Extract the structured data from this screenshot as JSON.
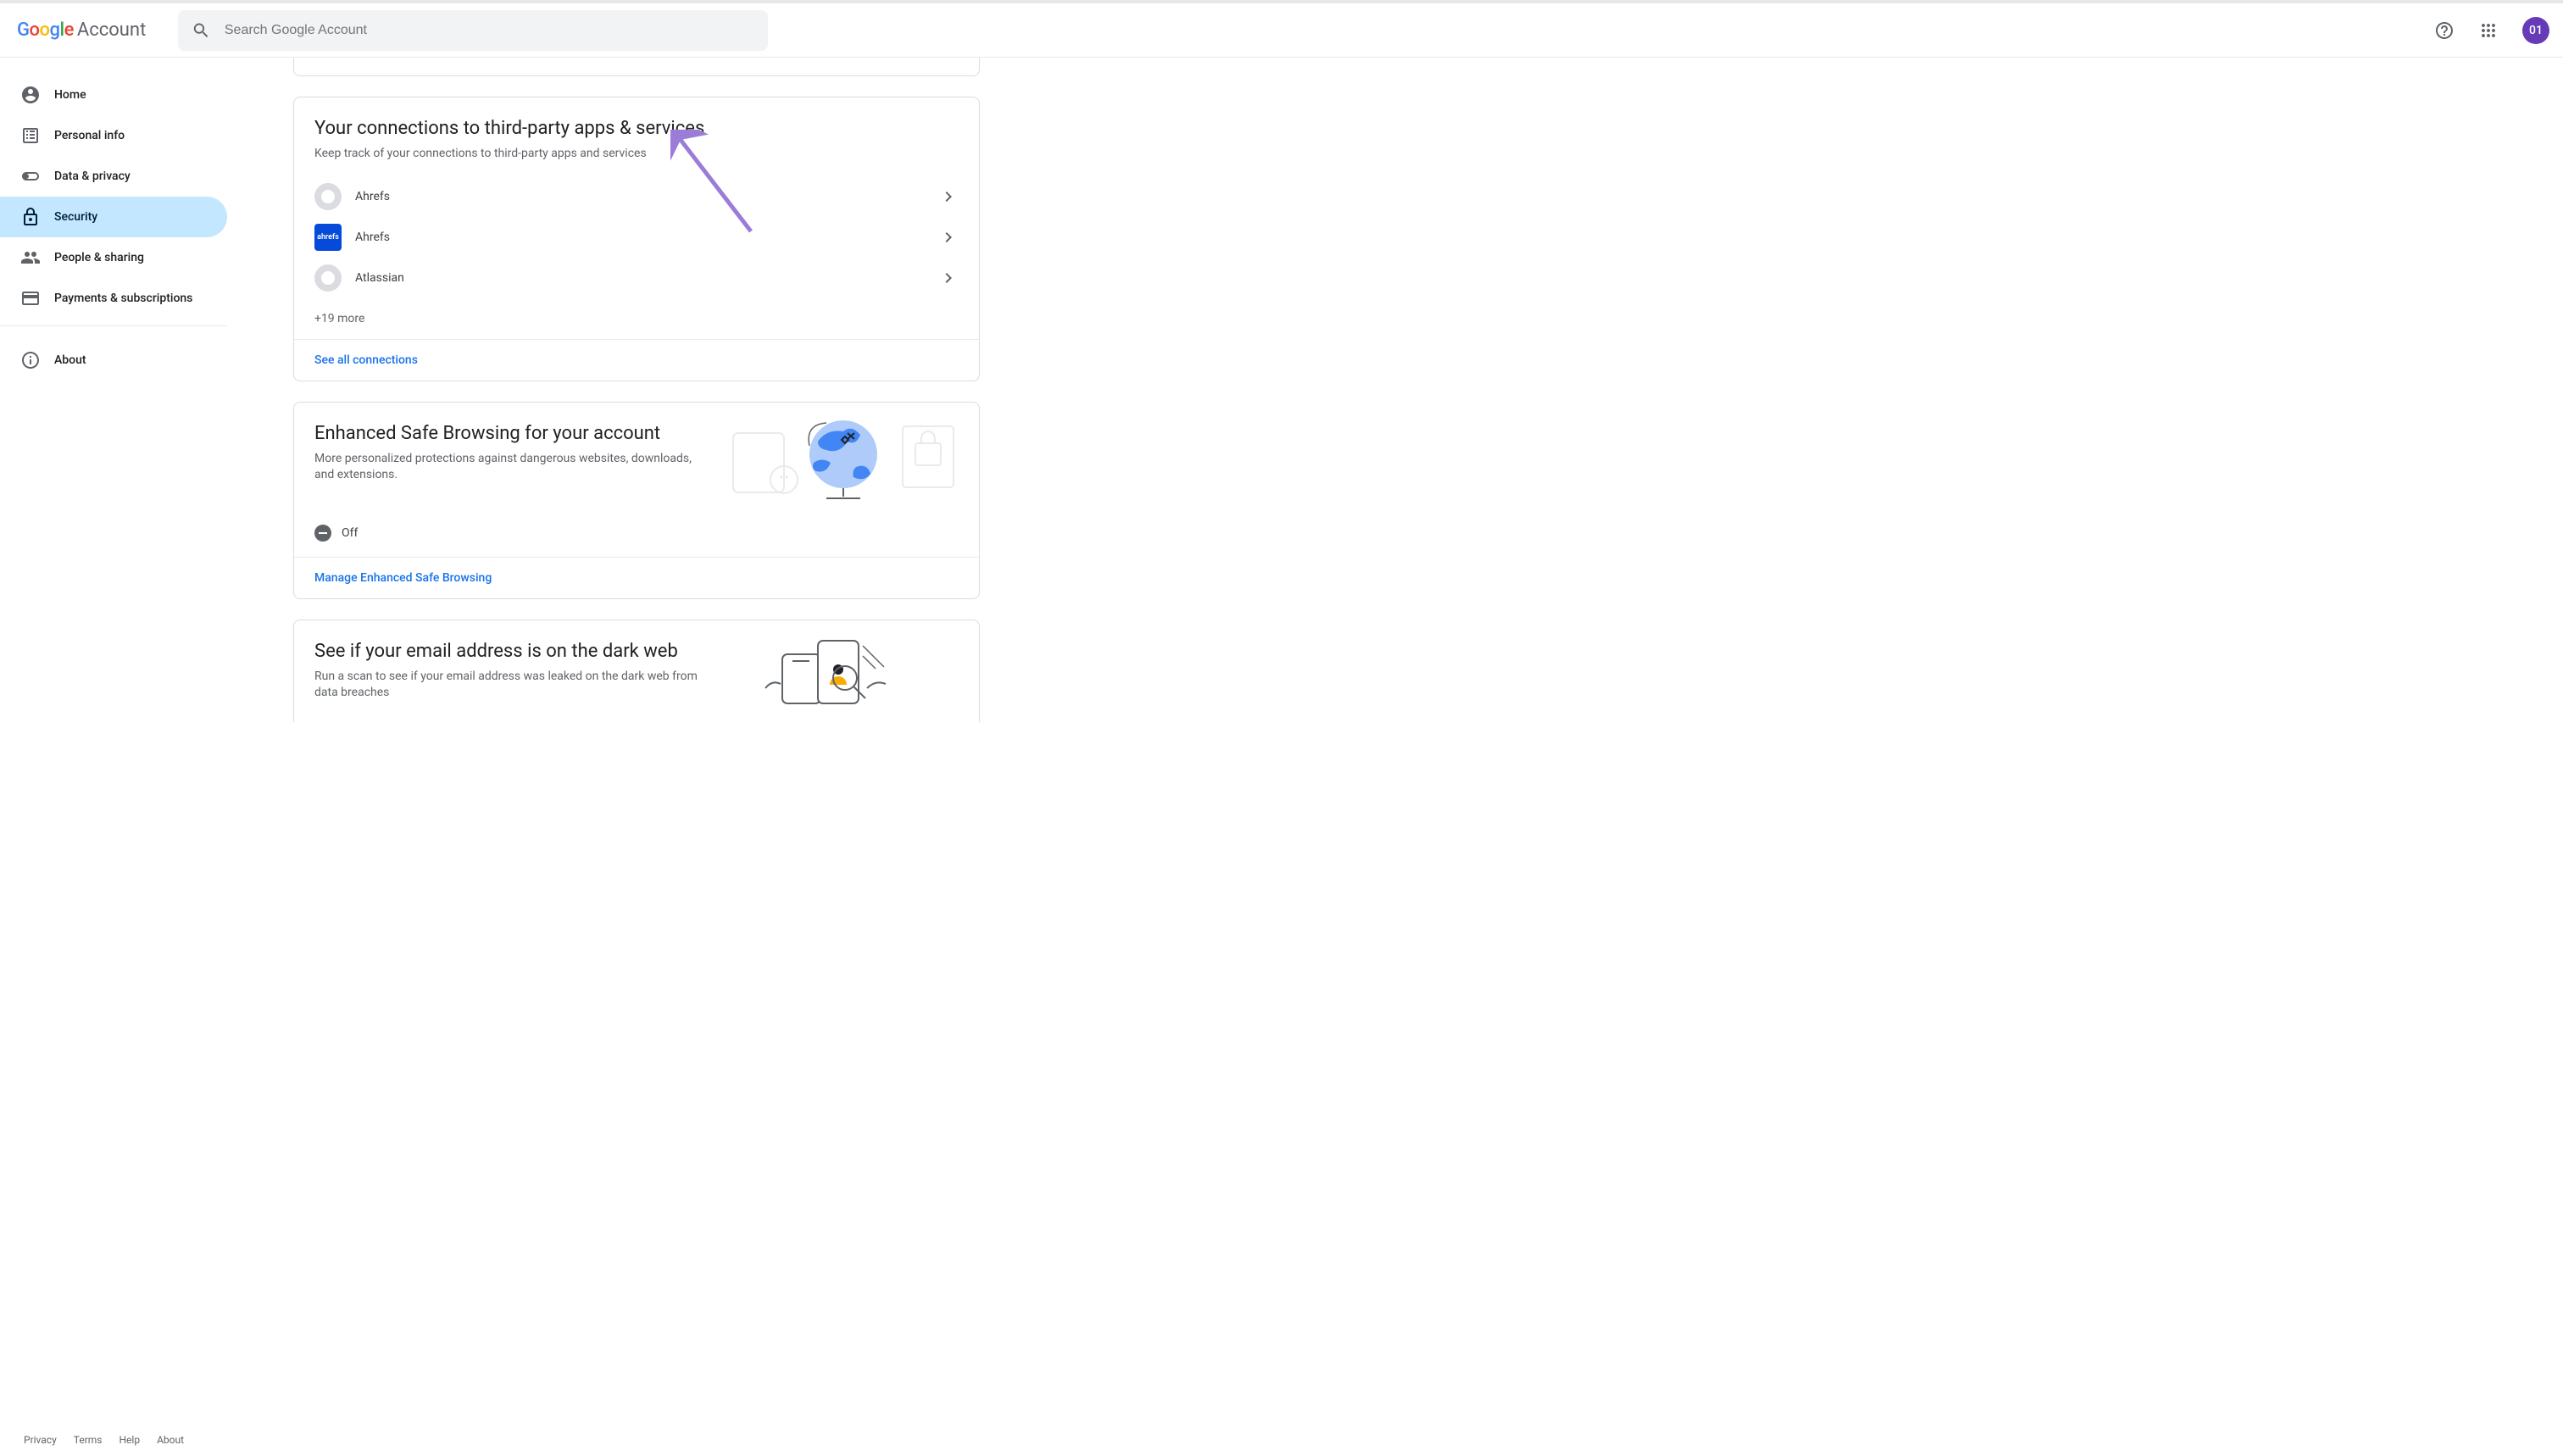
{
  "header": {
    "logo_suffix": "Account",
    "search_placeholder": "Search Google Account",
    "avatar_text": "01"
  },
  "sidebar": {
    "items": [
      {
        "label": "Home"
      },
      {
        "label": "Personal info"
      },
      {
        "label": "Data & privacy"
      },
      {
        "label": "Security"
      },
      {
        "label": "People & sharing"
      },
      {
        "label": "Payments & subscriptions"
      },
      {
        "label": "About"
      }
    ]
  },
  "footer": {
    "privacy": "Privacy",
    "terms": "Terms",
    "help": "Help",
    "about": "About"
  },
  "cards": {
    "connections": {
      "title": "Your connections to third-party apps & services",
      "subtitle": "Keep track of your connections to third-party apps and services",
      "items": [
        {
          "name": "Ahrefs",
          "icon_style": "gray"
        },
        {
          "name": "Ahrefs",
          "icon_style": "blue",
          "icon_text": "ahrefs"
        },
        {
          "name": "Atlassian",
          "icon_style": "gray"
        }
      ],
      "more": "+19 more",
      "action": "See all connections"
    },
    "safe_browsing": {
      "title": "Enhanced Safe Browsing for your account",
      "subtitle": "More personalized protections against dangerous websites, downloads, and extensions.",
      "status": "Off",
      "action": "Manage Enhanced Safe Browsing"
    },
    "dark_web": {
      "title": "See if your email address is on the dark web",
      "subtitle": "Run a scan to see if your email address was leaked on the dark web from data breaches"
    }
  }
}
